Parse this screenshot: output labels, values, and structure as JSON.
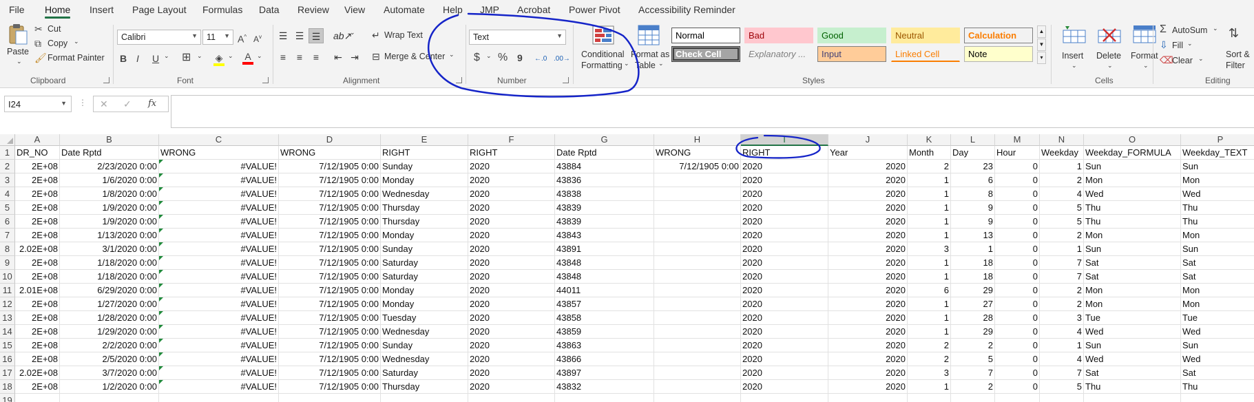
{
  "menu": {
    "tabs": [
      "File",
      "Home",
      "Insert",
      "Page Layout",
      "Formulas",
      "Data",
      "Review",
      "View",
      "Automate",
      "Help",
      "JMP",
      "Acrobat",
      "Power Pivot",
      "Accessibility Reminder"
    ],
    "active": "Home"
  },
  "ribbon": {
    "clipboard": {
      "paste": "Paste",
      "cut": "Cut",
      "copy": "Copy",
      "format_painter": "Format Painter",
      "label": "Clipboard"
    },
    "font": {
      "name": "Calibri",
      "size": "11",
      "bold": "B",
      "italic": "I",
      "underline": "U",
      "label": "Font"
    },
    "alignment": {
      "wrap_text": "Wrap Text",
      "merge_center": "Merge & Center",
      "label": "Alignment"
    },
    "number": {
      "format": "Text",
      "currency": "$",
      "percent": "%",
      "comma": "9",
      "label": "Number"
    },
    "styles": {
      "conditional": [
        "Conditional",
        "Formatting"
      ],
      "format_table": [
        "Format as",
        "Table"
      ],
      "cells": [
        {
          "label": "Normal",
          "bg": "#ffffff",
          "fg": "#000000",
          "border": "#5b5b5b"
        },
        {
          "label": "Bad",
          "bg": "#ffc7ce",
          "fg": "#9c0006",
          "border": "#ffc7ce"
        },
        {
          "label": "Good",
          "bg": "#c6efce",
          "fg": "#006100",
          "border": "#c6efce"
        },
        {
          "label": "Neutral",
          "bg": "#ffeb9c",
          "fg": "#9c5700",
          "border": "#ffeb9c"
        },
        {
          "label": "Calculation",
          "bg": "#f2f2f2",
          "fg": "#fa7d00",
          "border": "#7f7f7f"
        },
        {
          "label": "Check Cell",
          "bg": "#a5a5a5",
          "fg": "#ffffff",
          "border": "#3f3f3f"
        },
        {
          "label": "Explanatory ...",
          "bg": "#f3f3f3",
          "fg": "#7f7f7f",
          "border": "#f3f3f3"
        },
        {
          "label": "Input",
          "bg": "#ffcc99",
          "fg": "#3f3f76",
          "border": "#7f7f7f"
        },
        {
          "label": "Linked Cell",
          "bg": "#f3f3f3",
          "fg": "#fa7d00",
          "border": "#f3f3f3"
        },
        {
          "label": "Note",
          "bg": "#ffffcc",
          "fg": "#000000",
          "border": "#b2b2b2"
        }
      ],
      "label": "Styles"
    },
    "cells": {
      "insert": "Insert",
      "delete": "Delete",
      "format": "Format",
      "label": "Cells"
    },
    "editing": {
      "autosum": "AutoSum",
      "fill": "Fill",
      "clear": "Clear",
      "sort": [
        "Sort &",
        "Filter"
      ],
      "label": "Editing"
    }
  },
  "formula_bar": {
    "name_box": "I24",
    "cancel": "✕",
    "enter": "✓",
    "fx": "fx",
    "content": ""
  },
  "grid": {
    "columns": [
      "A",
      "B",
      "C",
      "D",
      "E",
      "F",
      "G",
      "H",
      "I",
      "J",
      "K",
      "L",
      "M",
      "N",
      "O",
      "P"
    ],
    "selected_column": "I",
    "rows": [
      [
        "DR_NO",
        "Date Rptd",
        "WRONG",
        "WRONG",
        "RIGHT",
        "RIGHT",
        "Date Rptd",
        "WRONG",
        "RIGHT",
        "Year",
        "Month",
        "Day",
        "Hour",
        "Weekday",
        "Weekday_FORMULA",
        "Weekday_TEXT"
      ],
      [
        "2E+08",
        "2/23/2020 0:00",
        "#VALUE!",
        "7/12/1905 0:00",
        "Sunday",
        "2020",
        "43884",
        "7/12/1905 0:00",
        "2020",
        "2020",
        "2",
        "23",
        "0",
        "1",
        "Sun",
        "Sun"
      ],
      [
        "2E+08",
        "1/6/2020 0:00",
        "#VALUE!",
        "7/12/1905 0:00",
        "Monday",
        "2020",
        "43836",
        "",
        "2020",
        "2020",
        "1",
        "6",
        "0",
        "2",
        "Mon",
        "Mon"
      ],
      [
        "2E+08",
        "1/8/2020 0:00",
        "#VALUE!",
        "7/12/1905 0:00",
        "Wednesday",
        "2020",
        "43838",
        "",
        "2020",
        "2020",
        "1",
        "8",
        "0",
        "4",
        "Wed",
        "Wed"
      ],
      [
        "2E+08",
        "1/9/2020 0:00",
        "#VALUE!",
        "7/12/1905 0:00",
        "Thursday",
        "2020",
        "43839",
        "",
        "2020",
        "2020",
        "1",
        "9",
        "0",
        "5",
        "Thu",
        "Thu"
      ],
      [
        "2E+08",
        "1/9/2020 0:00",
        "#VALUE!",
        "7/12/1905 0:00",
        "Thursday",
        "2020",
        "43839",
        "",
        "2020",
        "2020",
        "1",
        "9",
        "0",
        "5",
        "Thu",
        "Thu"
      ],
      [
        "2E+08",
        "1/13/2020 0:00",
        "#VALUE!",
        "7/12/1905 0:00",
        "Monday",
        "2020",
        "43843",
        "",
        "2020",
        "2020",
        "1",
        "13",
        "0",
        "2",
        "Mon",
        "Mon"
      ],
      [
        "2.02E+08",
        "3/1/2020 0:00",
        "#VALUE!",
        "7/12/1905 0:00",
        "Sunday",
        "2020",
        "43891",
        "",
        "2020",
        "2020",
        "3",
        "1",
        "0",
        "1",
        "Sun",
        "Sun"
      ],
      [
        "2E+08",
        "1/18/2020 0:00",
        "#VALUE!",
        "7/12/1905 0:00",
        "Saturday",
        "2020",
        "43848",
        "",
        "2020",
        "2020",
        "1",
        "18",
        "0",
        "7",
        "Sat",
        "Sat"
      ],
      [
        "2E+08",
        "1/18/2020 0:00",
        "#VALUE!",
        "7/12/1905 0:00",
        "Saturday",
        "2020",
        "43848",
        "",
        "2020",
        "2020",
        "1",
        "18",
        "0",
        "7",
        "Sat",
        "Sat"
      ],
      [
        "2.01E+08",
        "6/29/2020 0:00",
        "#VALUE!",
        "7/12/1905 0:00",
        "Monday",
        "2020",
        "44011",
        "",
        "2020",
        "2020",
        "6",
        "29",
        "0",
        "2",
        "Mon",
        "Mon"
      ],
      [
        "2E+08",
        "1/27/2020 0:00",
        "#VALUE!",
        "7/12/1905 0:00",
        "Monday",
        "2020",
        "43857",
        "",
        "2020",
        "2020",
        "1",
        "27",
        "0",
        "2",
        "Mon",
        "Mon"
      ],
      [
        "2E+08",
        "1/28/2020 0:00",
        "#VALUE!",
        "7/12/1905 0:00",
        "Tuesday",
        "2020",
        "43858",
        "",
        "2020",
        "2020",
        "1",
        "28",
        "0",
        "3",
        "Tue",
        "Tue"
      ],
      [
        "2E+08",
        "1/29/2020 0:00",
        "#VALUE!",
        "7/12/1905 0:00",
        "Wednesday",
        "2020",
        "43859",
        "",
        "2020",
        "2020",
        "1",
        "29",
        "0",
        "4",
        "Wed",
        "Wed"
      ],
      [
        "2E+08",
        "2/2/2020 0:00",
        "#VALUE!",
        "7/12/1905 0:00",
        "Sunday",
        "2020",
        "43863",
        "",
        "2020",
        "2020",
        "2",
        "2",
        "0",
        "1",
        "Sun",
        "Sun"
      ],
      [
        "2E+08",
        "2/5/2020 0:00",
        "#VALUE!",
        "7/12/1905 0:00",
        "Wednesday",
        "2020",
        "43866",
        "",
        "2020",
        "2020",
        "2",
        "5",
        "0",
        "4",
        "Wed",
        "Wed"
      ],
      [
        "2.02E+08",
        "3/7/2020 0:00",
        "#VALUE!",
        "7/12/1905 0:00",
        "Saturday",
        "2020",
        "43897",
        "",
        "2020",
        "2020",
        "3",
        "7",
        "0",
        "7",
        "Sat",
        "Sat"
      ],
      [
        "2E+08",
        "1/2/2020 0:00",
        "#VALUE!",
        "7/12/1905 0:00",
        "Thursday",
        "2020",
        "43832",
        "",
        "2020",
        "2020",
        "1",
        "2",
        "0",
        "5",
        "Thu",
        "Thu"
      ],
      [
        "",
        "",
        "",
        "",
        "",
        "",
        "",
        "",
        "",
        "",
        "",
        "",
        "",
        "",
        "",
        ""
      ]
    ]
  },
  "colors": {
    "accent": "#217346",
    "annotation": "#1524c8"
  }
}
